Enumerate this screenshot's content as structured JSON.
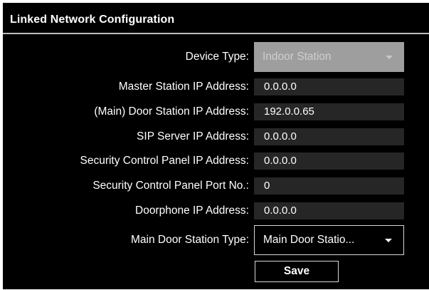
{
  "panel": {
    "title": "Linked Network Configuration"
  },
  "form": {
    "device_type": {
      "label": "Device Type:",
      "value": "Indoor Station",
      "disabled": true
    },
    "master_station_ip": {
      "label": "Master Station IP Address:",
      "value": "0.0.0.0"
    },
    "main_door_station_ip": {
      "label": "(Main) Door Station IP Address:",
      "value": "192.0.0.65"
    },
    "sip_server_ip": {
      "label": "SIP Server IP Address:",
      "value": "0.0.0.0"
    },
    "security_panel_ip": {
      "label": "Security Control Panel IP Address:",
      "value": "0.0.0.0"
    },
    "security_panel_port": {
      "label": "Security Control Panel Port No.:",
      "value": "0"
    },
    "doorphone_ip": {
      "label": "Doorphone IP Address:",
      "value": "0.0.0.0"
    },
    "main_door_station_type": {
      "label": "Main Door Station Type:",
      "value": "Main Door Statio..."
    }
  },
  "actions": {
    "save_label": "Save"
  },
  "icons": {
    "dropdown": "chevron-down-icon"
  },
  "colors": {
    "panel_bg": "#000000",
    "field_bg": "#262626",
    "disabled_select_bg": "#9e9e9e",
    "text": "#ffffff",
    "border": "#d6d6d6"
  }
}
